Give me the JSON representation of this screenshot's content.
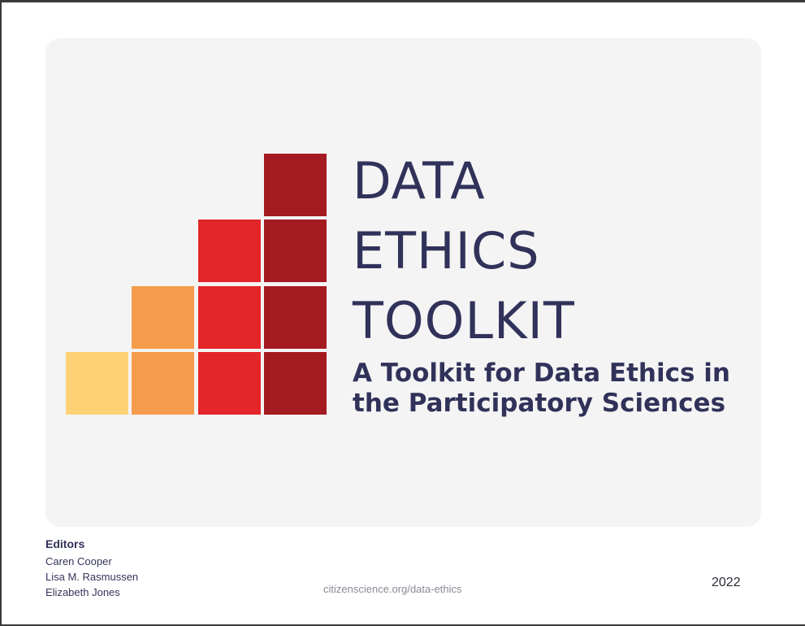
{
  "cover": {
    "title_lines": [
      "DATA",
      "ETHICS",
      "TOOLKIT"
    ],
    "subtitle_lines": [
      "A Toolkit for Data Ethics in",
      "the Participatory Sciences"
    ],
    "logo_colors": {
      "yellow": "#ffd175",
      "orange": "#f59b4c",
      "red": "#e32629",
      "dark_red": "#a31a20"
    }
  },
  "editors": {
    "heading": "Editors",
    "names": [
      "Caren Cooper",
      "Lisa M. Rasmussen",
      "Elizabeth Jones"
    ]
  },
  "footer": {
    "url": "citizenscience.org/data-ethics",
    "year": "2022"
  }
}
